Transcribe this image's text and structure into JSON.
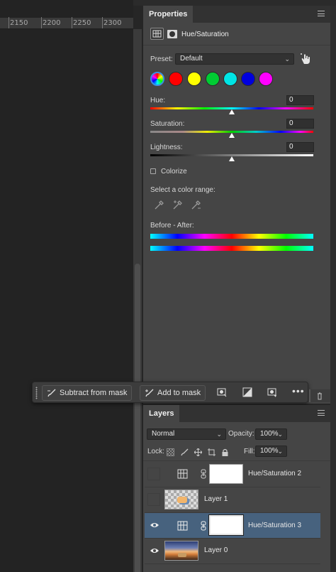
{
  "ruler": {
    "ticks": [
      "2150",
      "2200",
      "2250",
      "2300"
    ]
  },
  "properties": {
    "tab_label": "Properties",
    "adjustment_title": "Hue/Saturation",
    "preset_label": "Preset:",
    "preset_value": "Default",
    "hue_label": "Hue:",
    "hue_value": "0",
    "saturation_label": "Saturation:",
    "saturation_value": "0",
    "lightness_label": "Lightness:",
    "lightness_value": "0",
    "colorize_label": "Colorize",
    "color_range_label": "Select a color range:",
    "before_after_label": "Before - After:",
    "swatch_colors": [
      "#ff0000",
      "#ffff00",
      "#00cc33",
      "#00e5e5",
      "#0000dd",
      "#ff00ff"
    ],
    "accent": "#3b8fe3"
  },
  "mask_toolbar": {
    "subtract_label": "Subtract from mask",
    "add_label": "Add to mask",
    "more_label": "•••"
  },
  "layers": {
    "tab_label": "Layers",
    "blend_mode": "Normal",
    "opacity_label": "Opacity:",
    "opacity_value": "100%",
    "lock_label": "Lock:",
    "fill_label": "Fill:",
    "fill_value": "100%",
    "items": [
      {
        "name": "Hue/Saturation 2",
        "visible": false,
        "selected": false,
        "type": "adjustment"
      },
      {
        "name": "Layer 1",
        "visible": false,
        "selected": false,
        "type": "pixel"
      },
      {
        "name": "Hue/Saturation 3",
        "visible": true,
        "selected": true,
        "type": "adjustment"
      },
      {
        "name": "Layer 0",
        "visible": true,
        "selected": false,
        "type": "pixel"
      }
    ],
    "selected_color": "#47627e"
  }
}
